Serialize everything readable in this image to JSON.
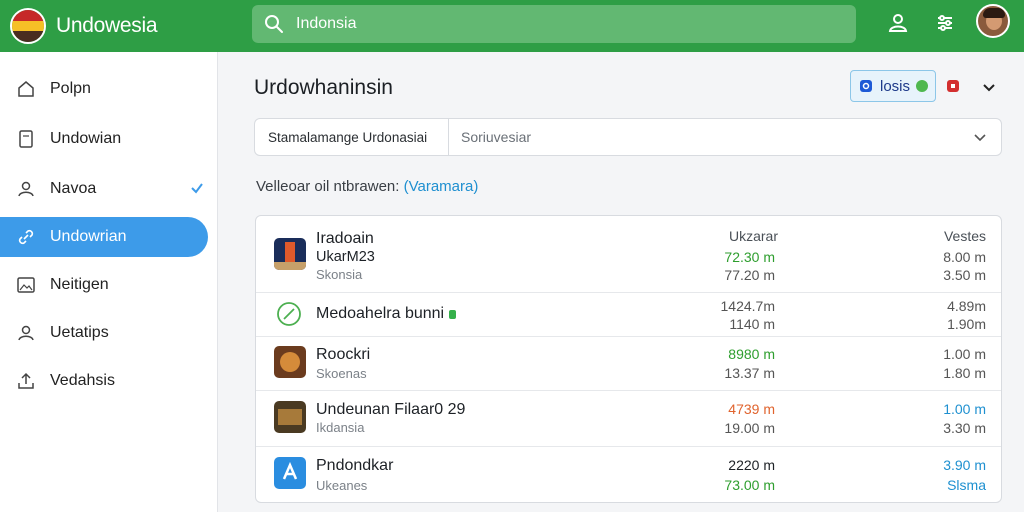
{
  "app": {
    "name": "Undowesia"
  },
  "search": {
    "value": "Indonsia"
  },
  "sidebar": {
    "items": [
      {
        "label": "Polpn",
        "icon": "home-icon"
      },
      {
        "label": "Undowian",
        "icon": "document-icon"
      },
      {
        "label": "Navoa",
        "icon": "user-icon"
      },
      {
        "label": "Undowrian",
        "icon": "link-icon"
      },
      {
        "label": "Neitigen",
        "icon": "image-icon"
      },
      {
        "label": "Uetatips",
        "icon": "people-icon"
      },
      {
        "label": "Vedahsis",
        "icon": "upload-icon"
      }
    ]
  },
  "main": {
    "title": "Urdowhaninsin",
    "badge": {
      "label": "losis"
    },
    "filter": {
      "left": "Stamalamange Urdonasiai",
      "right": "Soriuvesiar"
    },
    "subtitle": {
      "text": "Velleoar oil ntbrawen:",
      "highlight": "(Varamara)"
    }
  },
  "table": {
    "headers": [
      "Ukzarar",
      "Vestes"
    ],
    "rows": [
      {
        "name": "Iradoain",
        "line2": "UkarM23",
        "sub": "Skonsia",
        "v1a": "72.30 m",
        "v1b": "77.20 m",
        "v2a": "8.00 m",
        "v2b": "3.50 m"
      },
      {
        "name": "Medoahelra bunni",
        "line2": "",
        "sub": "",
        "v1a": "1424.7m",
        "v1b": "1140 m",
        "v2a": "4.89m",
        "v2b": "1.90m"
      },
      {
        "name": "Roockri",
        "line2": "",
        "sub": "Skoenas",
        "v1a": "8980 m",
        "v1b": "13.37 m",
        "v2a": "1.00 m",
        "v2b": "1.80 m"
      },
      {
        "name": "Undeunan Filaar0 29",
        "line2": "",
        "sub": "Ikdansia",
        "v1a": "4739 m",
        "v1b": "19.00 m",
        "v2a": "1.00 m",
        "v2b": "3.30 m"
      },
      {
        "name": "Pndondkar",
        "line2": "",
        "sub": "Ukeanes",
        "v1a": "2220 m",
        "v1b": "73.00 m",
        "v2a": "3.90 m",
        "v2b": "Slsma"
      }
    ]
  },
  "colors": {
    "header_green": "#2e9e45",
    "active_blue": "#3d9be9",
    "value_green": "#2e9e2e",
    "value_orange": "#e0632d",
    "value_blue": "#1e90d0"
  }
}
